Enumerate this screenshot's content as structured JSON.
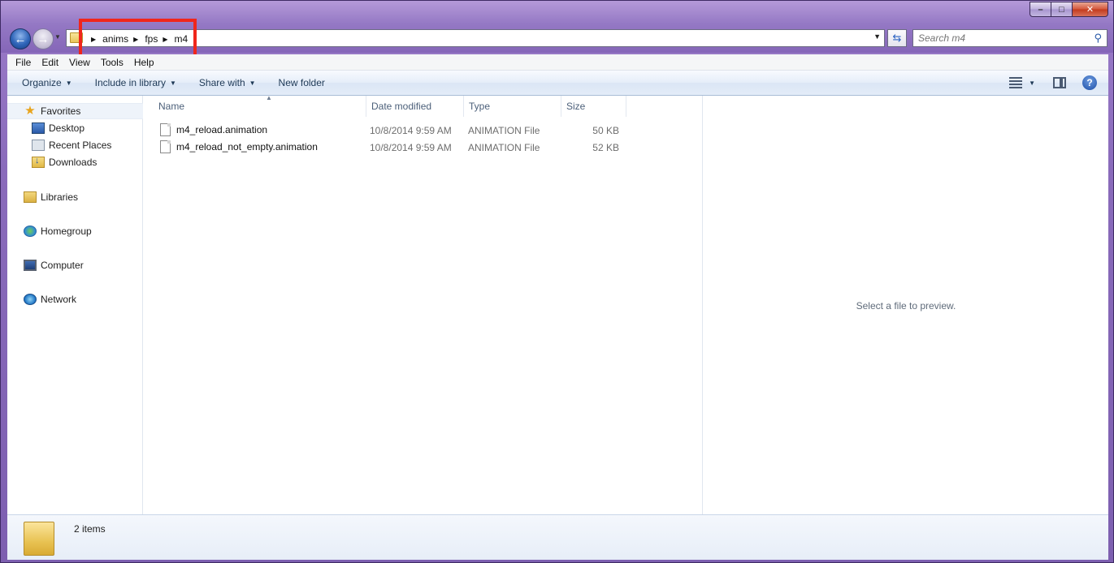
{
  "window": {
    "caption": {
      "minimize": "–",
      "maximize": "□",
      "close": "✕"
    }
  },
  "nav": {
    "back_glyph": "←",
    "forward_glyph": "→",
    "breadcrumbs": [
      "anims",
      "fps",
      "m4"
    ],
    "search_placeholder": "Search m4"
  },
  "menubar": {
    "items": [
      "File",
      "Edit",
      "View",
      "Tools",
      "Help"
    ]
  },
  "commandbar": {
    "organize": "Organize",
    "include_in_library": "Include in library",
    "share_with": "Share with",
    "new_folder": "New folder"
  },
  "sidebar": {
    "favorites": "Favorites",
    "favorites_items": [
      "Desktop",
      "Recent Places",
      "Downloads"
    ],
    "libraries": "Libraries",
    "homegroup": "Homegroup",
    "computer": "Computer",
    "network": "Network"
  },
  "file_list": {
    "columns": [
      "Name",
      "Date modified",
      "Type",
      "Size"
    ],
    "rows": [
      {
        "name": "m4_reload.animation",
        "date": "10/8/2014 9:59 AM",
        "type": "ANIMATION File",
        "size": "50 KB"
      },
      {
        "name": "m4_reload_not_empty.animation",
        "date": "10/8/2014 9:59 AM",
        "type": "ANIMATION File",
        "size": "52 KB"
      }
    ]
  },
  "preview": {
    "message": "Select a file to preview."
  },
  "details": {
    "item_count": "2 items"
  },
  "colors": {
    "accent_highlight": "#f0261b",
    "frame": "#8a6bbb"
  }
}
